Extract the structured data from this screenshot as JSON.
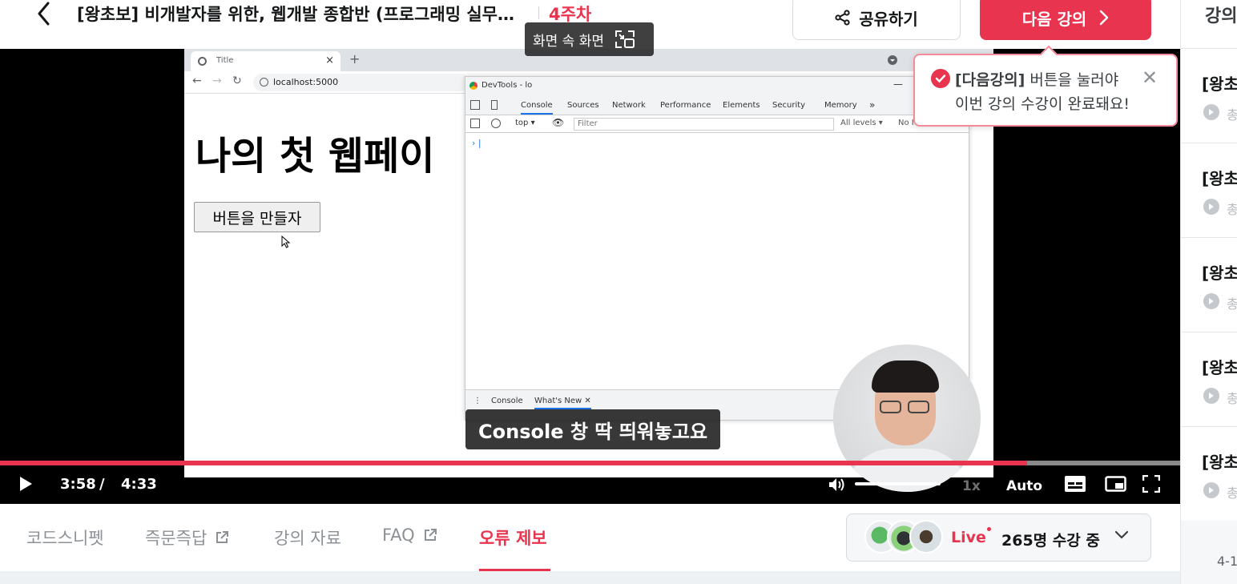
{
  "header": {
    "course_title": "[왕초보] 비개발자를 위한, 웹개발 종합반 (프로그래밍 실무…",
    "week": "4주차",
    "share_label": "공유하기",
    "next_label": "다음 강의"
  },
  "video": {
    "browser": {
      "tab_title": "Title",
      "url": "localhost:5000",
      "page_heading": "나의 첫 웹페이",
      "page_button": "버튼을 만들자"
    },
    "devtools": {
      "window_title": "DevTools - lo",
      "tabs": [
        "Console",
        "Sources",
        "Network",
        "Performance",
        "Elements",
        "Security",
        "Memory",
        "»"
      ],
      "context": "top ▾",
      "filter_placeholder": "Filter",
      "levels": "All levels ▾",
      "issues": "No I",
      "prompt": "›  |",
      "drawer_tabs": [
        "Console",
        "What's New ✕"
      ]
    },
    "pip_label": "화면 속 화면",
    "caption": "Console 창 딱 띄워놓고요",
    "progress_fraction": 0.87,
    "current_time": "3:58",
    "time_separator": "/",
    "duration": "4:33",
    "volume_fraction": 1.0,
    "speed": "1x",
    "quality": "Auto"
  },
  "toast": {
    "bold": "[다음강의]",
    "line1_rest": " 버튼을 눌러야",
    "line2": "이번 강의 수강이 완료돼요!",
    "close": "✕"
  },
  "bottom_tabs": [
    {
      "label": "코드스니펫",
      "external": false
    },
    {
      "label": "즉문즉답",
      "external": true
    },
    {
      "label": "강의 자료",
      "external": false
    },
    {
      "label": "FAQ",
      "external": true
    },
    {
      "label": "오류 제보",
      "external": false,
      "active": true
    }
  ],
  "live": {
    "label": "Live",
    "count": "265명 수강 중"
  },
  "sidebar": {
    "title": "강의",
    "lessons": [
      {
        "title": "[왕초",
        "meta": "총"
      },
      {
        "title": "[왕초",
        "meta": "총"
      },
      {
        "title": "[왕초",
        "meta": "총"
      },
      {
        "title": "[왕초",
        "meta": "총"
      },
      {
        "title": "[왕초",
        "meta": "총"
      }
    ],
    "footer": "4-1"
  },
  "colors": {
    "accent": "#e8344e",
    "text": "#141617",
    "muted": "#8c9196"
  }
}
